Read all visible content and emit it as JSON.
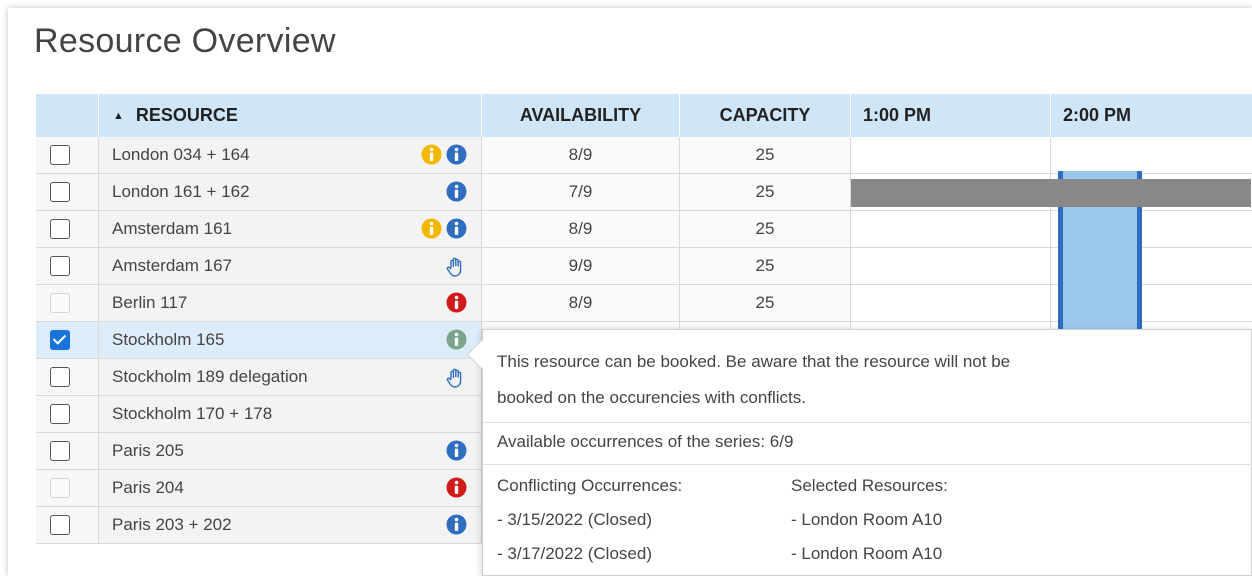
{
  "page": {
    "title": "Resource Overview"
  },
  "columns": {
    "resource": "RESOURCE",
    "availability": "AVAILABILITY",
    "capacity": "CAPACITY",
    "time1": "1:00 PM",
    "time2": "2:00 PM"
  },
  "rows": [
    {
      "name": "London 034 + 164",
      "availability": "8/9",
      "capacity": "25",
      "checkbox": "unchecked",
      "icons": [
        "warning-info-icon",
        "info-icon"
      ]
    },
    {
      "name": "London 161 + 162",
      "availability": "7/9",
      "capacity": "25",
      "checkbox": "unchecked",
      "icons": [
        "info-icon"
      ]
    },
    {
      "name": "Amsterdam 161",
      "availability": "8/9",
      "capacity": "25",
      "checkbox": "unchecked",
      "icons": [
        "warning-info-icon",
        "info-icon"
      ]
    },
    {
      "name": "Amsterdam 167",
      "availability": "9/9",
      "capacity": "25",
      "checkbox": "unchecked",
      "icons": [
        "hand-icon"
      ]
    },
    {
      "name": "Berlin 117",
      "availability": "8/9",
      "capacity": "25",
      "checkbox": "disabled",
      "icons": [
        "error-info-icon"
      ]
    },
    {
      "name": "Stockholm 165",
      "availability": "",
      "capacity": "",
      "checkbox": "checked",
      "icons": [
        "available-info-icon"
      ]
    },
    {
      "name": "Stockholm 189 delegation",
      "availability": "",
      "capacity": "",
      "checkbox": "unchecked",
      "icons": [
        "hand-icon"
      ]
    },
    {
      "name": "Stockholm 170 + 178",
      "availability": "",
      "capacity": "",
      "checkbox": "unchecked",
      "icons": []
    },
    {
      "name": "Paris 205",
      "availability": "",
      "capacity": "",
      "checkbox": "unchecked",
      "icons": [
        "info-icon"
      ]
    },
    {
      "name": "Paris 204",
      "availability": "",
      "capacity": "",
      "checkbox": "disabled",
      "icons": [
        "error-info-icon"
      ]
    },
    {
      "name": "Paris 203 + 202",
      "availability": "",
      "capacity": "",
      "checkbox": "unchecked",
      "icons": [
        "info-icon"
      ]
    }
  ],
  "tooltip": {
    "message_line1": "This resource can be booked. Be aware that the resource will not be",
    "message_line2": "booked on the occurencies with conflicts.",
    "available_text": "Available occurrences of the series: 6/9",
    "conflicting_header": "Conflicting Occurrences:",
    "conflicting": [
      "- 3/15/2022 (Closed)",
      "- 3/17/2022 (Closed)"
    ],
    "selected_header": "Selected Resources:",
    "selected": [
      "- London Room A10",
      "- London Room A10"
    ]
  },
  "colors": {
    "header_bg": "#cfe6f8",
    "info_blue": "#2f6ebf",
    "warning_yellow": "#f2b800",
    "error_red": "#d11a1a",
    "available_green": "#7aa58a",
    "busy_gray": "#888888",
    "selection_blue": "#9cc7ec"
  }
}
